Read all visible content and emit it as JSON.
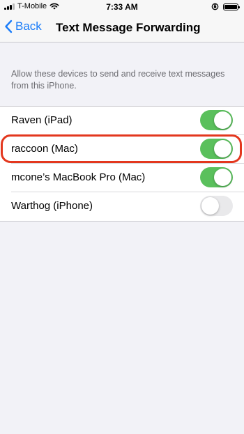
{
  "status_bar": {
    "carrier": "T-Mobile",
    "time": "7:33 AM"
  },
  "nav": {
    "back_label": "Back",
    "title": "Text Message Forwarding"
  },
  "section": {
    "description": "Allow these devices to send and receive text messages from this iPhone."
  },
  "devices": [
    {
      "label": "Raven (iPad)",
      "enabled": true
    },
    {
      "label": "raccoon (Mac)",
      "enabled": true
    },
    {
      "label": "mcone’s MacBook Pro (Mac)",
      "enabled": true
    },
    {
      "label": "Warthog (iPhone)",
      "enabled": false
    }
  ],
  "colors": {
    "accent": "#1a7cf9",
    "toggle_on": "#5ac05c",
    "highlight": "#e3371e"
  }
}
